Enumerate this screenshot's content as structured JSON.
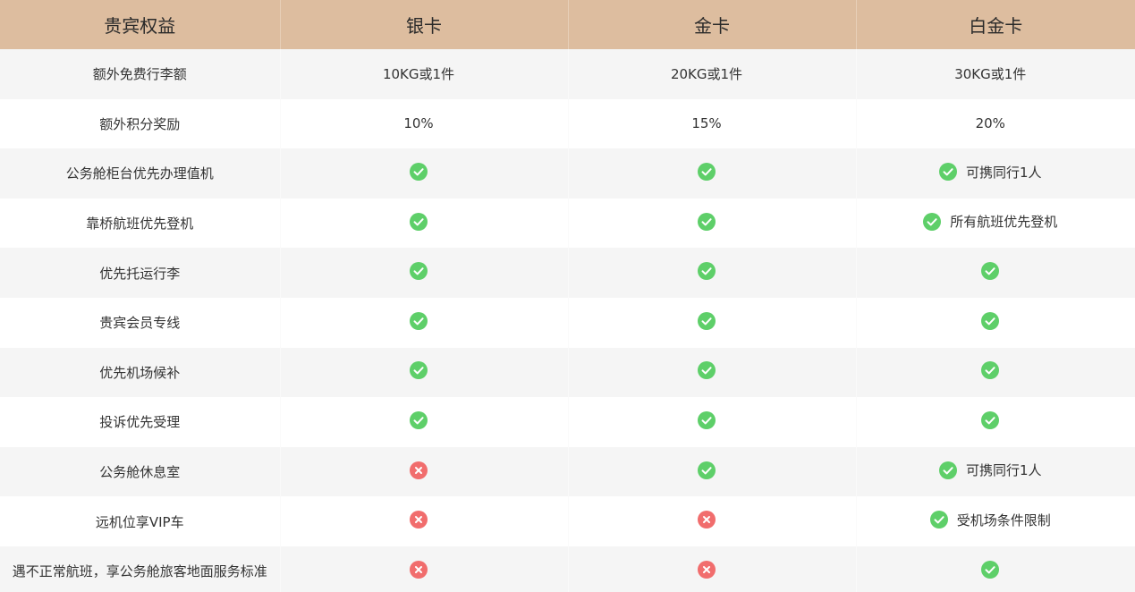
{
  "colors": {
    "header_bg": "#ddbd9f",
    "check": "#5ecf69",
    "cross": "#f16d6d",
    "stripe": "#f5f5f5"
  },
  "header": {
    "benefit": "贵宾权益",
    "tiers": [
      "银卡",
      "金卡",
      "白金卡"
    ]
  },
  "rows": [
    {
      "benefit": "额外免费行李额",
      "cells": [
        {
          "text": "10KG或1件"
        },
        {
          "text": "20KG或1件"
        },
        {
          "text": "30KG或1件"
        }
      ]
    },
    {
      "benefit": "额外积分奖励",
      "cells": [
        {
          "text": "10%"
        },
        {
          "text": "15%"
        },
        {
          "text": "20%"
        }
      ]
    },
    {
      "benefit": "公务舱柜台优先办理值机",
      "cells": [
        {
          "icon": "check-icon"
        },
        {
          "icon": "check-icon"
        },
        {
          "icon": "check-icon",
          "note": "可携同行1人"
        }
      ]
    },
    {
      "benefit": "靠桥航班优先登机",
      "cells": [
        {
          "icon": "check-icon"
        },
        {
          "icon": "check-icon"
        },
        {
          "icon": "check-icon",
          "note": "所有航班优先登机"
        }
      ]
    },
    {
      "benefit": "优先托运行李",
      "cells": [
        {
          "icon": "check-icon"
        },
        {
          "icon": "check-icon"
        },
        {
          "icon": "check-icon"
        }
      ]
    },
    {
      "benefit": "贵宾会员专线",
      "cells": [
        {
          "icon": "check-icon"
        },
        {
          "icon": "check-icon"
        },
        {
          "icon": "check-icon"
        }
      ]
    },
    {
      "benefit": "优先机场候补",
      "cells": [
        {
          "icon": "check-icon"
        },
        {
          "icon": "check-icon"
        },
        {
          "icon": "check-icon"
        }
      ]
    },
    {
      "benefit": "投诉优先受理",
      "cells": [
        {
          "icon": "check-icon"
        },
        {
          "icon": "check-icon"
        },
        {
          "icon": "check-icon"
        }
      ]
    },
    {
      "benefit": "公务舱休息室",
      "cells": [
        {
          "icon": "cross-icon"
        },
        {
          "icon": "check-icon"
        },
        {
          "icon": "check-icon",
          "note": "可携同行1人"
        }
      ]
    },
    {
      "benefit": "远机位享VIP车",
      "cells": [
        {
          "icon": "cross-icon"
        },
        {
          "icon": "cross-icon"
        },
        {
          "icon": "check-icon",
          "note": "受机场条件限制"
        }
      ]
    },
    {
      "benefit": "遇不正常航班，享公务舱旅客地面服务标准",
      "cells": [
        {
          "icon": "cross-icon"
        },
        {
          "icon": "cross-icon"
        },
        {
          "icon": "check-icon"
        }
      ]
    }
  ]
}
